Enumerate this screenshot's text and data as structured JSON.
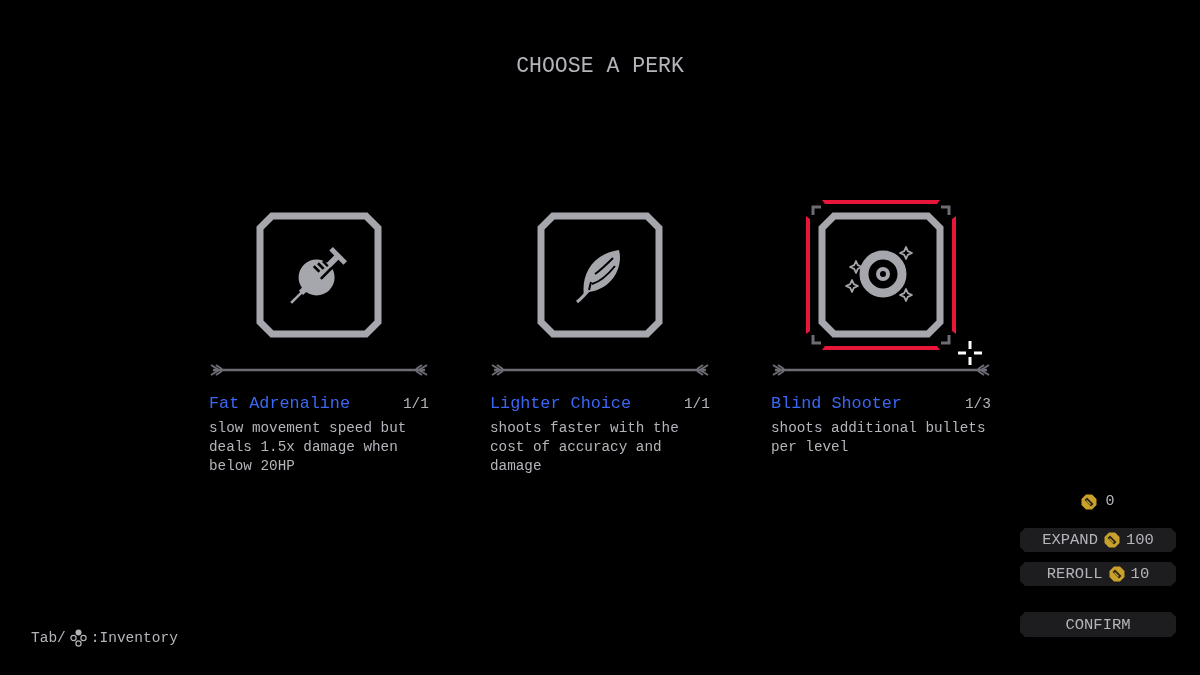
{
  "title": "CHOOSE A PERK",
  "perks": [
    {
      "name": "Fat Adrenaline",
      "count": "1/1",
      "description": "slow movement speed but deals 1.5x damage when below 20HP",
      "selected": false
    },
    {
      "name": "Lighter Choice",
      "count": "1/1",
      "description": "shoots faster with the cost of accuracy and damage",
      "selected": false
    },
    {
      "name": "Blind Shooter",
      "count": "1/3",
      "description": "shoots additional bullets per level",
      "selected": true
    }
  ],
  "balance": "0",
  "actions": [
    {
      "label": "EXPAND",
      "cost": "100"
    },
    {
      "label": "REROLL",
      "cost": "10"
    }
  ],
  "confirm": "CONFIRM",
  "hint": {
    "key": "Tab/",
    "action": ":Inventory"
  }
}
